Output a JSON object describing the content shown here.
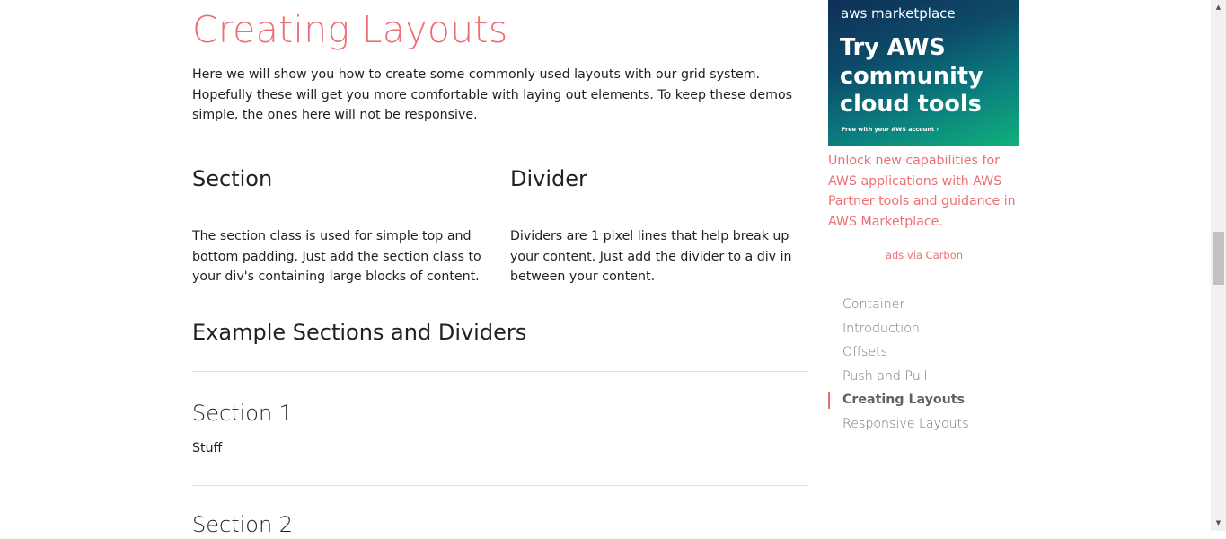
{
  "main": {
    "title": "Creating Layouts",
    "intro": "Here we will show you how to create some commonly used layouts with our grid system. Hopefully these will get you more comfortable with laying out elements. To keep these demos simple, the ones here will not be responsive.",
    "columns": [
      {
        "heading": "Section",
        "text": "The section class is used for simple top and bottom padding. Just add the section class to your div's containing large blocks of content."
      },
      {
        "heading": "Divider",
        "text": "Dividers are 1 pixel lines that help break up your content. Just add the divider to a div in between your content."
      }
    ],
    "example_heading": "Example Sections and Dividers",
    "sections": [
      {
        "title": "Section 1",
        "text": "Stuff"
      },
      {
        "title": "Section 2"
      }
    ]
  },
  "sidebar": {
    "ad": {
      "brand": "aws marketplace",
      "headline": "Try AWS community cloud tools",
      "cta": "Free with your AWS account ›",
      "text": "Unlock new capabilities for AWS applications with AWS Partner tools and guidance in AWS Marketplace.",
      "via": "ads via Carbon"
    },
    "toc": [
      {
        "label": "Container",
        "active": false
      },
      {
        "label": "Introduction",
        "active": false
      },
      {
        "label": "Offsets",
        "active": false
      },
      {
        "label": "Push and Pull",
        "active": false
      },
      {
        "label": "Creating Layouts",
        "active": true
      },
      {
        "label": "Responsive Layouts",
        "active": false
      }
    ]
  },
  "colors": {
    "accent": "#ee6e73",
    "text": "#212121",
    "muted": "#757575",
    "divider": "#e0e0e0"
  },
  "icons": {
    "scroll_up": "triangle-up",
    "scroll_down": "triangle-down"
  }
}
